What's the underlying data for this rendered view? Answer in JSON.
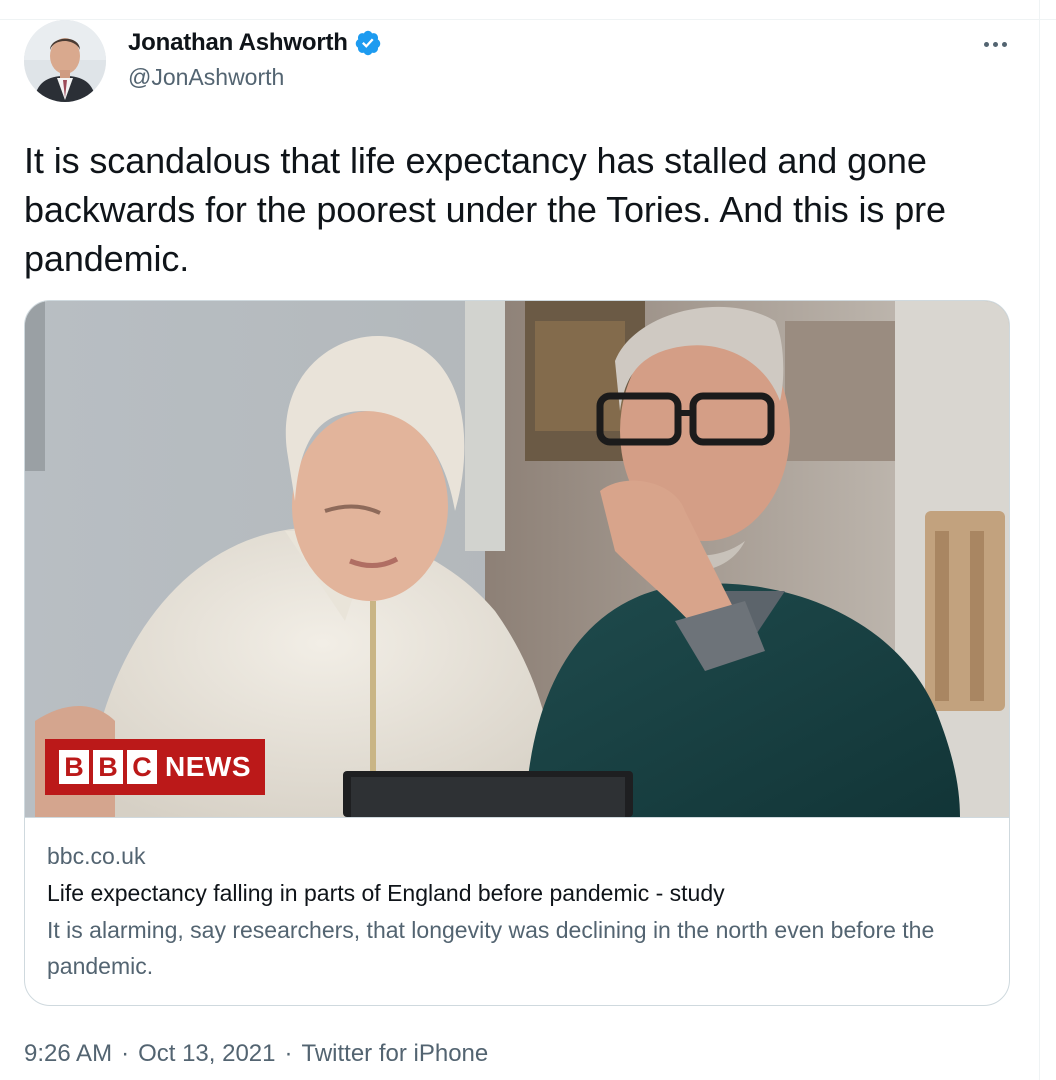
{
  "author": {
    "display_name": "Jonathan Ashworth",
    "handle": "@JonAshworth",
    "verified": true
  },
  "icons": {
    "avatar": "profile-photo",
    "verified": "verified-badge-icon",
    "more": "more-options-icon"
  },
  "tweet": {
    "text": "It is scandalous that life expectancy has stalled and gone backwards for the poorest under the Tories. And this is pre pandemic."
  },
  "card": {
    "image_alt": "Older couple looking at a tablet",
    "badge": {
      "letters": [
        "B",
        "B",
        "C"
      ],
      "word": "NEWS"
    },
    "domain": "bbc.co.uk",
    "title": "Life expectancy falling in parts of England before pandemic - study",
    "description": "It is alarming, say researchers, that longevity was declining in the north even before the pandemic."
  },
  "meta": {
    "time": "9:26 AM",
    "separator": "·",
    "date": "Oct 13, 2021",
    "source": "Twitter for iPhone"
  },
  "colors": {
    "text_primary": "#0f1419",
    "text_secondary": "#536471",
    "border": "#cfd9de",
    "verified_blue": "#1d9bf0",
    "bbc_red": "#bb1919"
  }
}
